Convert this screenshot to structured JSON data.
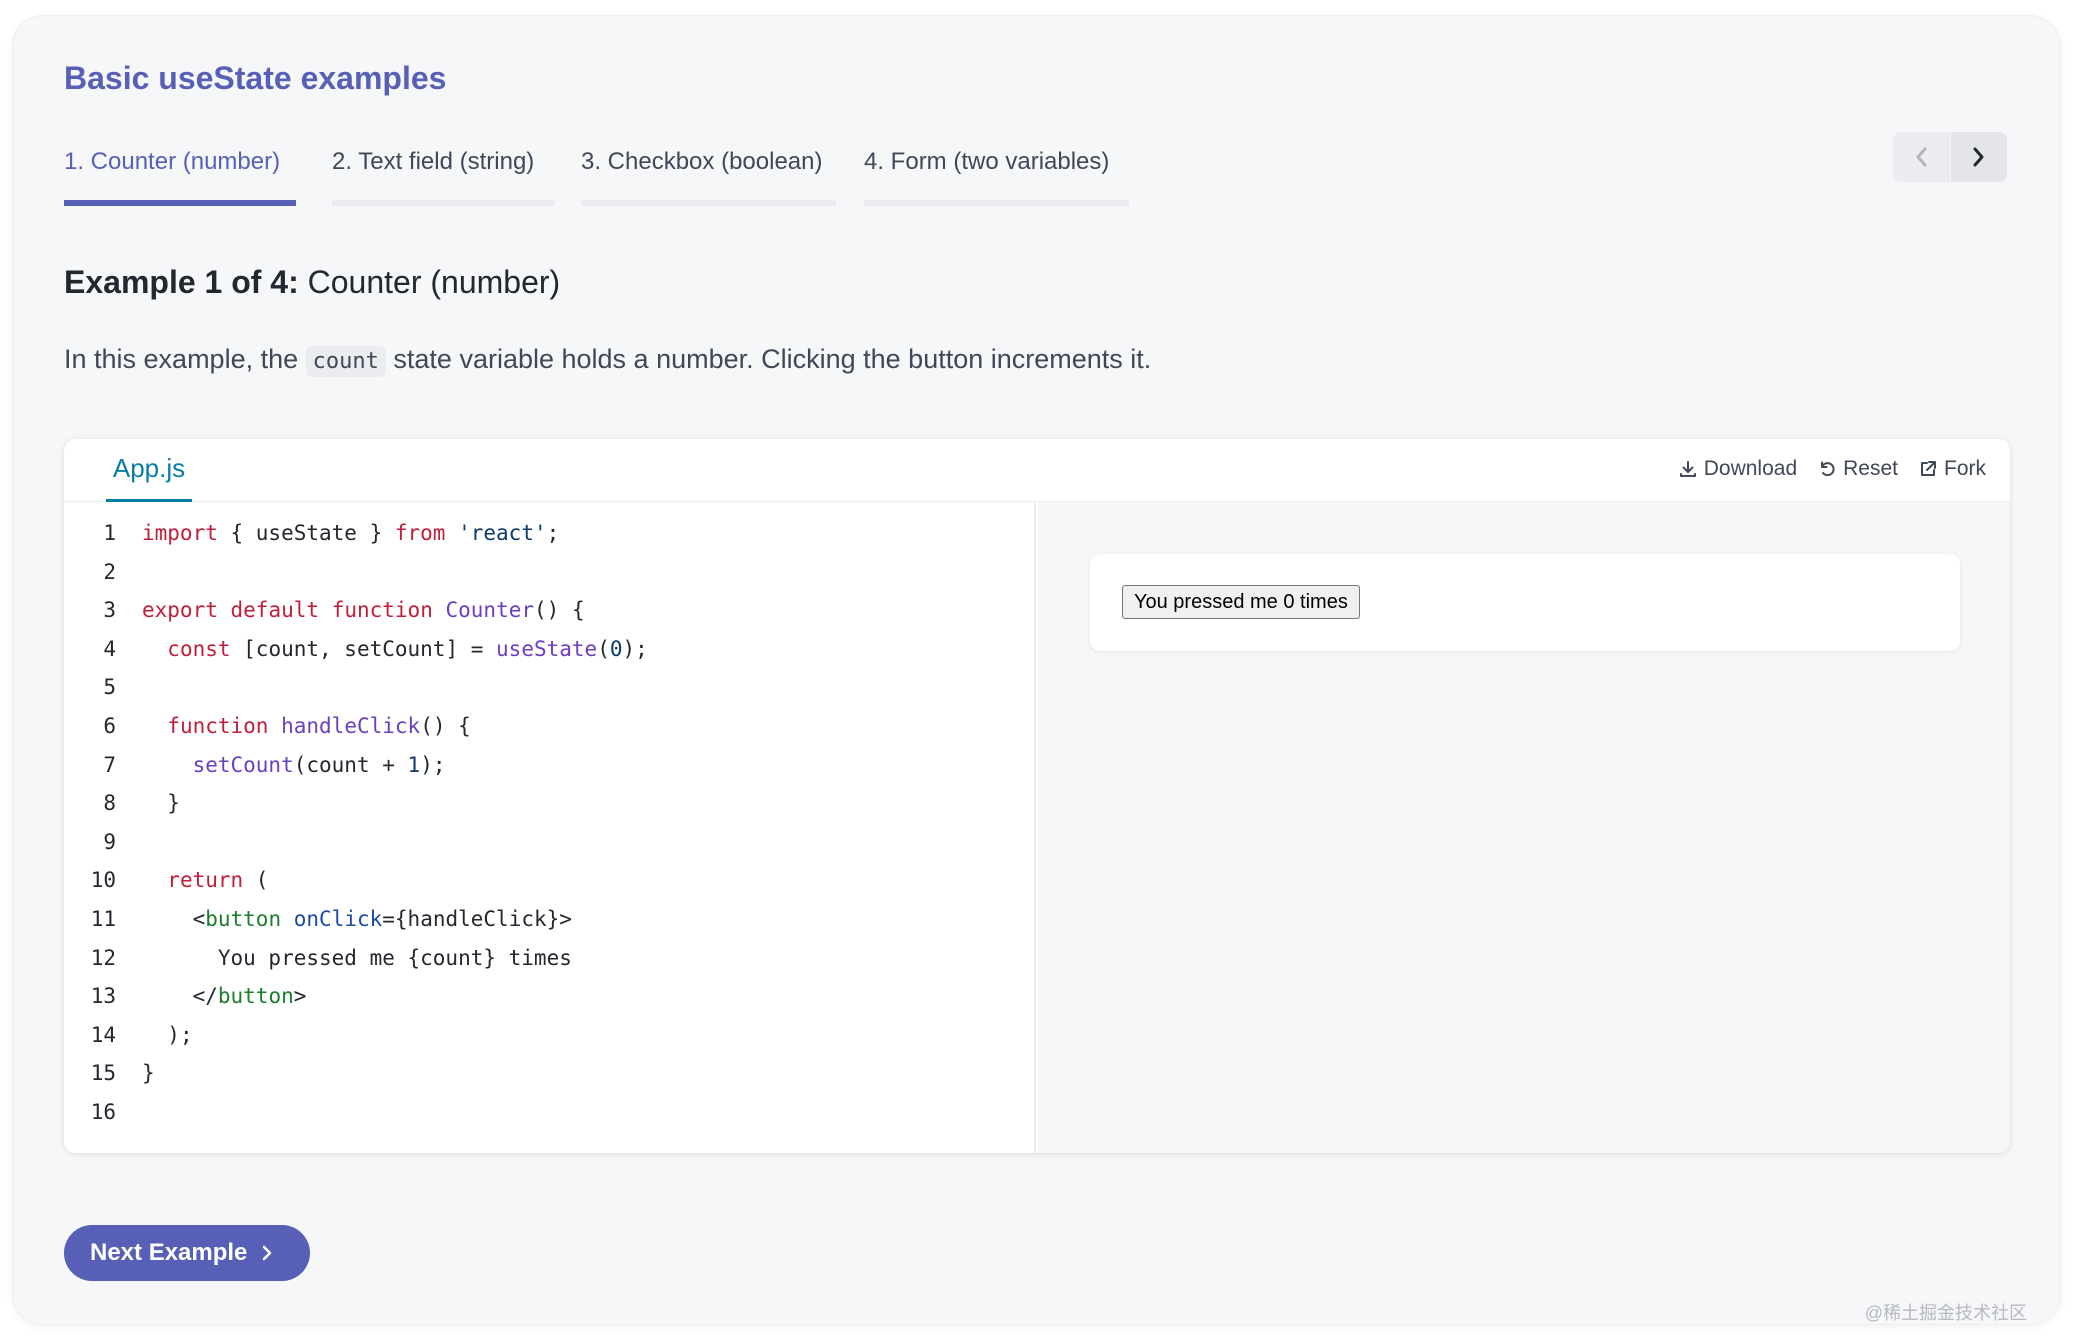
{
  "card": {
    "title": "Basic useState examples"
  },
  "tabs": [
    {
      "label": "1. Counter (number)",
      "active": true
    },
    {
      "label": "2. Text field (string)",
      "active": false
    },
    {
      "label": "3. Checkbox (boolean)",
      "active": false
    },
    {
      "label": "4. Form (two variables)",
      "active": false
    }
  ],
  "pager": {
    "prev_icon": "chevron-left-icon",
    "next_icon": "chevron-right-icon"
  },
  "example": {
    "prefix": "Example 1 of 4:",
    "title": "Counter (number)",
    "desc_before": "In this example, the",
    "desc_code": "count",
    "desc_after": "state variable holds a number. Clicking the button increments it."
  },
  "sandbox": {
    "file_tab": "App.js",
    "actions": {
      "download": "Download",
      "reset": "Reset",
      "fork": "Fork"
    },
    "line_numbers": [
      "1",
      "2",
      "3",
      "4",
      "5",
      "6",
      "7",
      "8",
      "9",
      "10",
      "11",
      "12",
      "13",
      "14",
      "15",
      "16"
    ],
    "preview_button": "You pressed me 0 times"
  },
  "code_tokens": {
    "import": "import",
    "lbrace_useState_rbrace": " { useState } ",
    "from": "from",
    "react": "'react'",
    "semi": ";",
    "export": "export",
    "default": "default",
    "function": "function",
    "Counter": "Counter",
    "parens_brace": "() {",
    "const": "const",
    "destructure": " [count, setCount] = ",
    "useState": "useState",
    "lp": "(",
    "zero": "0",
    "rp_semi": ");",
    "handleClick": "handleClick",
    "setCount": "setCount",
    "count_plus": "(count + ",
    "one": "1",
    "close_brace": "}",
    "return": "return",
    "lparen": " (",
    "lt": "<",
    "button": "button",
    "onClick": "onClick",
    "onclick_val": "={handleClick}>",
    "line12": "You pressed me {count} times",
    "lt_slash": "</",
    "gt": ">",
    "rparen_semi": ");"
  },
  "next_button": {
    "label": "Next Example"
  },
  "watermark": "@稀土掘金技术社区",
  "colors": {
    "accent": "#575fb7",
    "link": "#087ea4",
    "keyword": "#c21e3a",
    "function": "#6b3fc2",
    "tag": "#1b7d2e"
  }
}
